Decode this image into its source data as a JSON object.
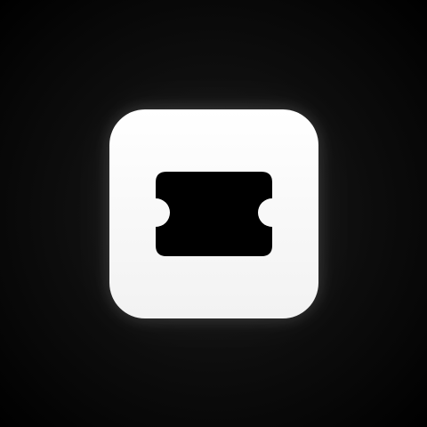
{
  "app_icon": {
    "icon": "ticket-icon",
    "tile_color": "#ffffff",
    "glyph_color": "#000000",
    "background_color": "#000000"
  }
}
